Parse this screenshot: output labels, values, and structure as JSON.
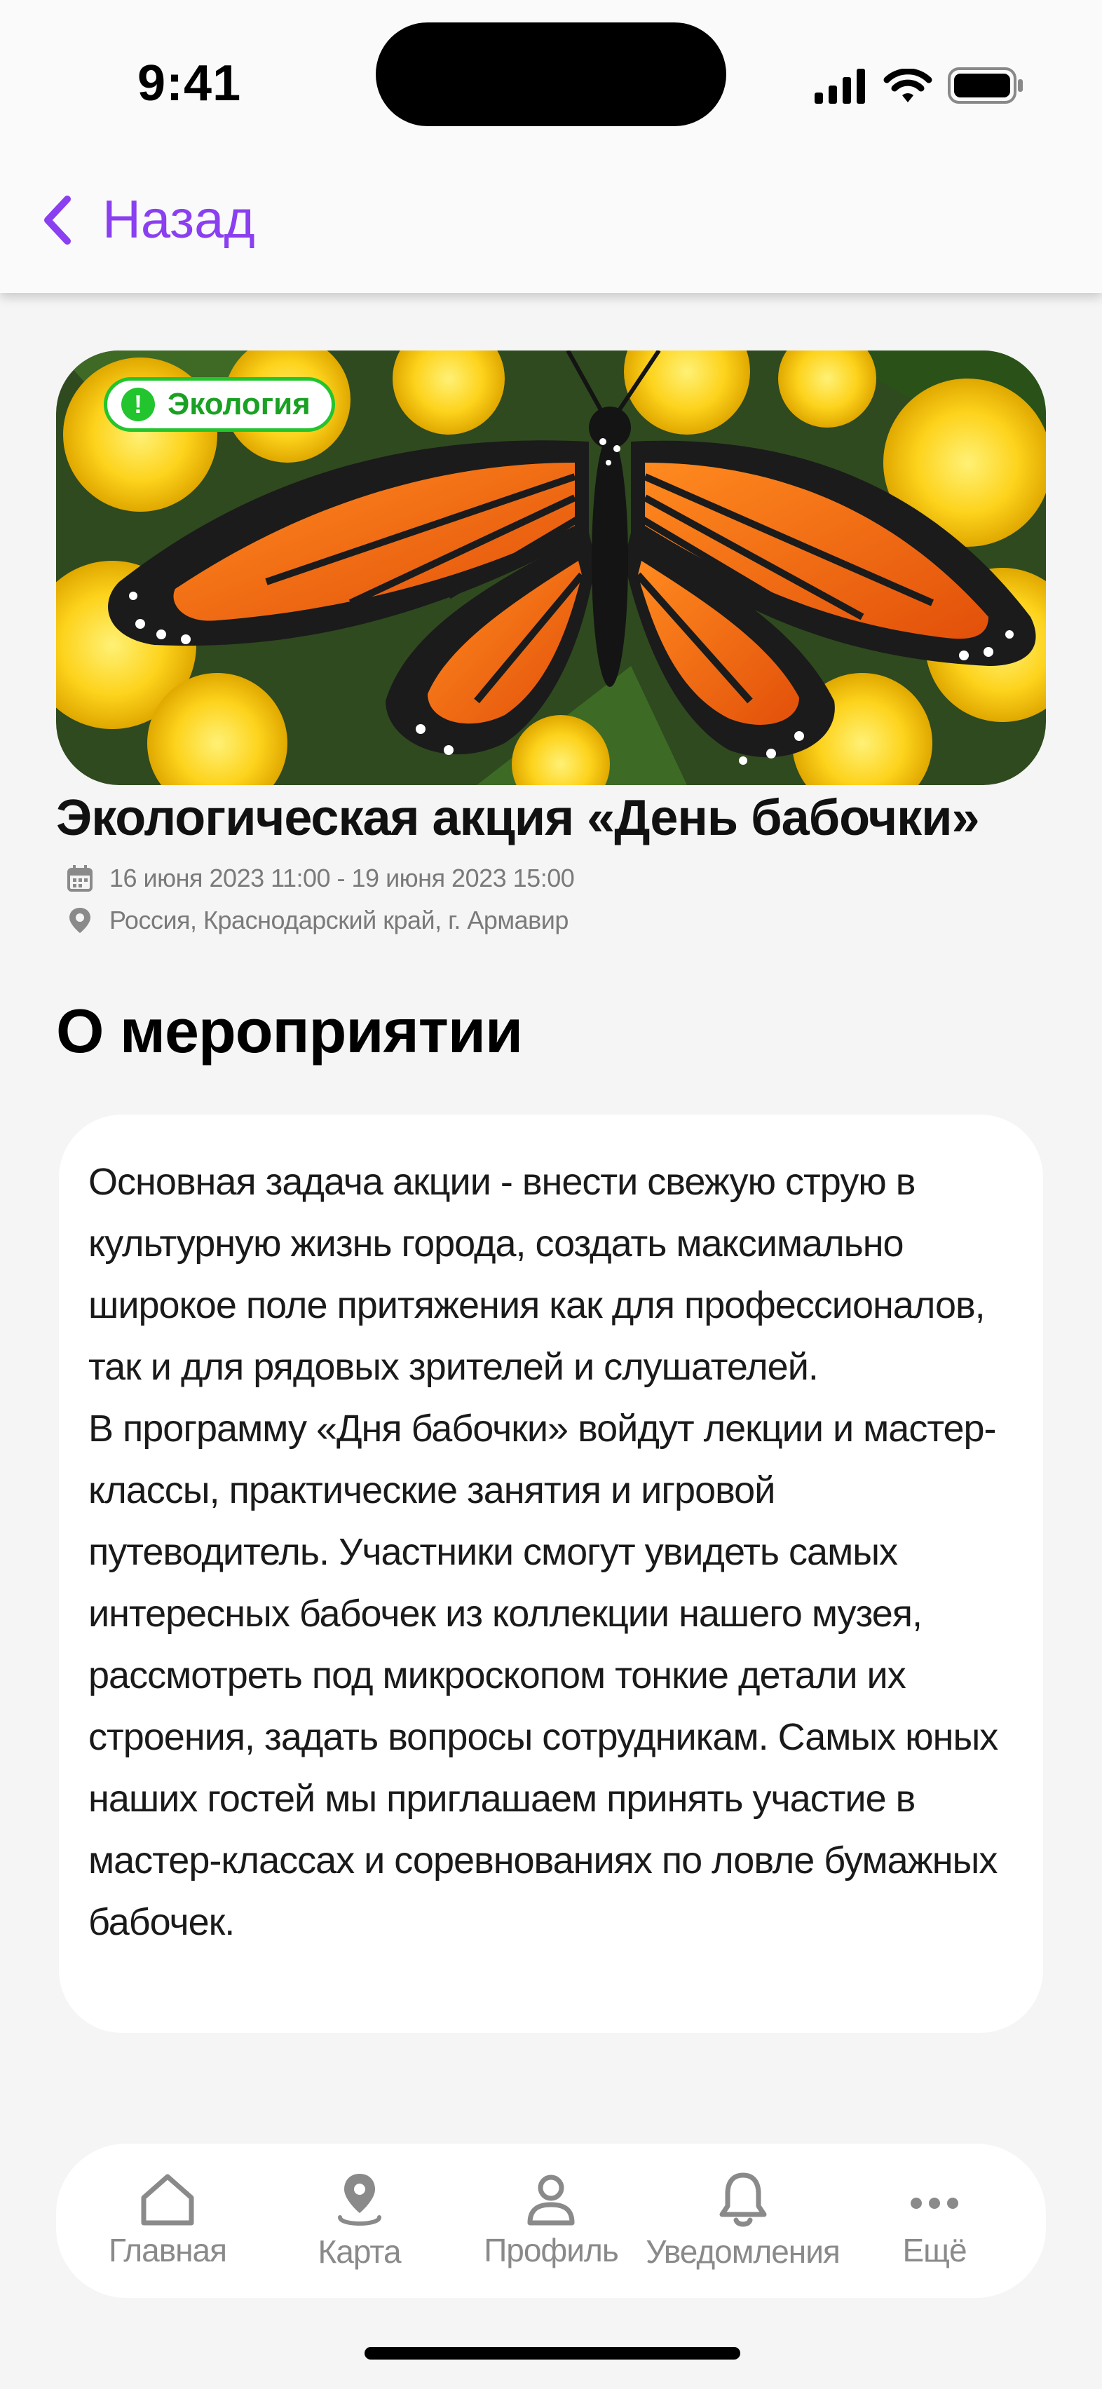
{
  "status_bar": {
    "time": "9:41",
    "signal_icon": "cellular-signal-icon",
    "wifi_icon": "wifi-icon",
    "battery_icon": "battery-icon"
  },
  "nav": {
    "back_label": "Назад",
    "back_icon": "chevron-left-icon",
    "accent": "#8a3ff0"
  },
  "event": {
    "category": "Экология",
    "category_color": "#22c52e",
    "title": "Экологическая акция «День бабочки»",
    "date_range": "16 июня 2023 11:00 - 19 июня 2023 15:00",
    "location": "Россия, Краснодарский край, г. Армавир"
  },
  "about": {
    "heading": "О мероприятии",
    "paragraphs": [
      "Основная задача акции - внести свежую струю в культурную жизнь города, создать максимально широкое поле притяжения как для профессионалов, так и для рядовых зрителей и слушателей.",
      "В программу «Дня бабочки» войдут лекции и мастер-классы, практические занятия и игровой путеводитель. Участники смогут увидеть самых интересных бабочек из коллекции нашего музея, рассмотреть под микроскопом тонкие детали их строения, задать вопросы сотрудникам. Самых юных наших гостей мы приглашаем принять участие в мастер-классах и соревнованиях по ловле бумажных бабочек."
    ]
  },
  "tabbar": {
    "items": [
      {
        "label": "Главная",
        "icon": "home-icon"
      },
      {
        "label": "Карта",
        "icon": "map-pin-icon"
      },
      {
        "label": "Профиль",
        "icon": "user-icon"
      },
      {
        "label": "Уведомления",
        "icon": "bell-icon"
      },
      {
        "label": "Ещё",
        "icon": "more-dots-icon"
      }
    ]
  }
}
